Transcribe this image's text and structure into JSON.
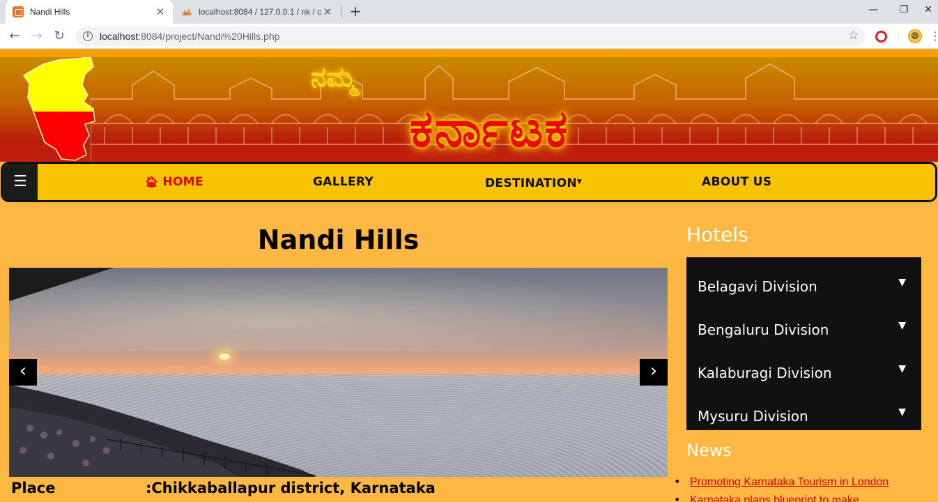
{
  "browser": {
    "tabs": [
      {
        "title": "Nandi Hills",
        "active": true,
        "icon": "xampp-icon"
      },
      {
        "title": "localhost:8084 / 127.0.0.1 / nk / c",
        "active": false,
        "icon": "phpmyadmin-icon"
      }
    ],
    "url_host": "localhost",
    "url_rest": ":8084/project/Nandi%20Hills.php"
  },
  "banner": {
    "namma": "ನಮ್ಮ",
    "karnataka": "ಕರ್ನಾಟಕ"
  },
  "nav": {
    "menu_icon": "☰",
    "home": "HOME",
    "gallery": "GALLERY",
    "destination": "DESTINATION",
    "about": "ABOUT US"
  },
  "main": {
    "title": "Nandi Hills",
    "carousel": {
      "prev": "‹",
      "next": "›"
    },
    "place_label": "Place",
    "place_value": ":Chikkaballapur district, Karnataka"
  },
  "sidebar": {
    "hotels_heading": "Hotels",
    "divisions": [
      "Belagavi Division",
      "Bengaluru Division",
      "Kalaburagi Division",
      "Mysuru Division"
    ],
    "news_heading": "News",
    "news": [
      "Promoting Karnataka Tourism in London",
      "Karnataka plans blueprint to make"
    ]
  },
  "colors": {
    "page_bg": "#fdb844",
    "nav_bg": "#f8c300",
    "accent_red": "#e00000",
    "panel_bg": "#111111"
  }
}
